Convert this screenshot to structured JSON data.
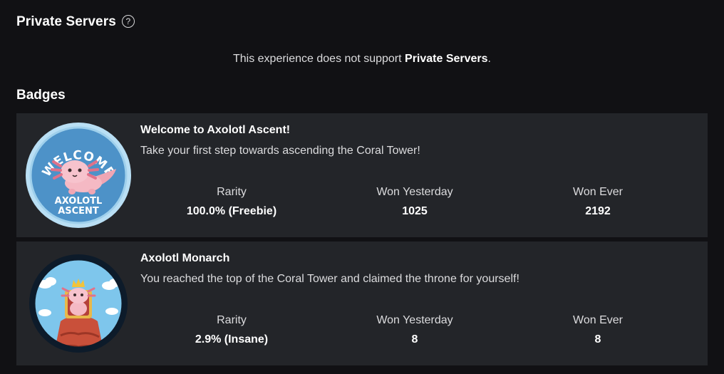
{
  "private_servers": {
    "title": "Private Servers",
    "help_icon": "question-circle-icon",
    "message_prefix": "This experience does not support ",
    "message_strong": "Private Servers",
    "message_suffix": "."
  },
  "badges": {
    "title": "Badges",
    "stat_labels": {
      "rarity": "Rarity",
      "won_yesterday": "Won Yesterday",
      "won_ever": "Won Ever"
    },
    "items": [
      {
        "name": "Welcome to Axolotl Ascent!",
        "description": "Take your first step towards ascending the Coral Tower!",
        "image_text_top": "WELCOME",
        "image_text_bottom_1": "AXOLOTL",
        "image_text_bottom_2": "ASCENT",
        "rarity": "100.0% (Freebie)",
        "won_yesterday": "1025",
        "won_ever": "2192"
      },
      {
        "name": "Axolotl Monarch",
        "description": "You reached the top of the Coral Tower and claimed the throne for yourself!",
        "rarity": "2.9% (Insane)",
        "won_yesterday": "8",
        "won_ever": "8"
      }
    ]
  },
  "colors": {
    "background": "#111114",
    "card": "#232529",
    "badge1_ring": "#9fd0ec",
    "badge1_fill": "#4a8fc4",
    "axolotl_pink": "#f5b9c4",
    "badge2_ring": "#0d1b2a",
    "badge2_sky": "#7ec6ec",
    "coral": "#c9503a"
  }
}
